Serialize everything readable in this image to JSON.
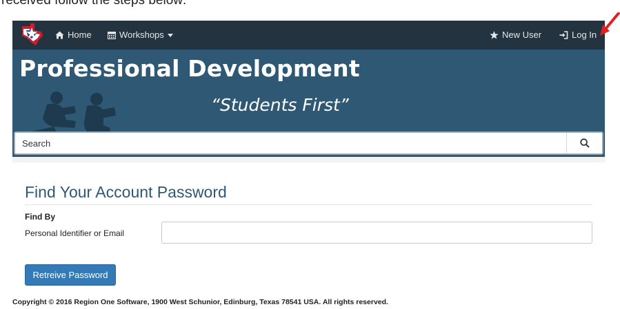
{
  "document": {
    "leading_text": "received follow the steps below:"
  },
  "navbar": {
    "home_label": "Home",
    "workshops_label": "Workshops",
    "new_user_label": "New User",
    "login_label": "Log In"
  },
  "banner": {
    "title": "Professional Development",
    "subtitle": "“Students First”"
  },
  "search": {
    "placeholder": "Search"
  },
  "form": {
    "title": "Find Your Account Password",
    "find_by_label": "Find By",
    "field_label": "Personal Identifier or Email",
    "field_value": "",
    "submit_label": "Retreive Password"
  },
  "footer": {
    "copyright": "Copyright © 2016 Region One Software, 1900 West Schunior, Edinburg, Texas 78541 USA. All rights reserved."
  },
  "colors": {
    "navbar_bg": "#243340",
    "banner_bg": "#2e5874",
    "title_blue": "#2e5874",
    "button_blue": "#337ab7",
    "annotation_arrow": "#e02020"
  },
  "icons": {
    "home": "home-icon",
    "workshops": "calendar-icon",
    "dropdown": "caret-down-icon",
    "new_user": "star-icon",
    "login": "login-icon",
    "search": "search-icon"
  }
}
